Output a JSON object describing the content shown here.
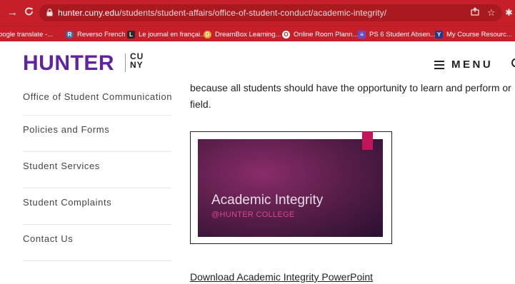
{
  "browser": {
    "url_host": "hunter.cuny.edu",
    "url_path": "/students/student-affairs/office-of-student-conduct/academic-integrity/",
    "back_icon": "arrow-right-icon",
    "reload_icon": "reload-icon",
    "share_icon": "share-icon",
    "bookmark_icon": "star-icon",
    "extensions_icon": "puzzle-icon",
    "bar_color": "#c5202a"
  },
  "bookmarks": [
    {
      "label": "oogle translate -...",
      "icon": "",
      "icon_color": ""
    },
    {
      "label": "Reverso French",
      "icon": "R",
      "icon_color": "#3a6fb0"
    },
    {
      "label": "Le journal en françai...",
      "icon": "L",
      "icon_color": "#2b2b2b"
    },
    {
      "label": "DreamBox Learning...",
      "icon": "D",
      "icon_color": "#f2a12b"
    },
    {
      "label": "Online Room Plann...",
      "icon": "O",
      "icon_color": "#ffffff"
    },
    {
      "label": "PS 6 Student Absen...",
      "icon": "≡",
      "icon_color": "#6a4cc2"
    },
    {
      "label": "My Course Resourc...",
      "icon": "Y",
      "icon_color": "#1d3c8c"
    }
  ],
  "header": {
    "logo_text": "HUNTER",
    "logo_cuny_top": "CU",
    "logo_cuny_bottom": "NY",
    "menu_label": "MENU",
    "brand_color": "#5f259f"
  },
  "sidebar": {
    "items": [
      {
        "label": "Office of Student Communication"
      },
      {
        "label": "Policies and Forms"
      },
      {
        "label": "Student Services"
      },
      {
        "label": "Student Complaints"
      },
      {
        "label": "Contact Us"
      }
    ]
  },
  "main": {
    "paragraph_line1": "because all students should have the opportunity to learn and perform or",
    "paragraph_line2": "field.",
    "slide_title": "Academic Integrity",
    "slide_subtitle": "@HUNTER COLLEGE",
    "download_link": "Download Academic Integrity PowerPoint"
  }
}
